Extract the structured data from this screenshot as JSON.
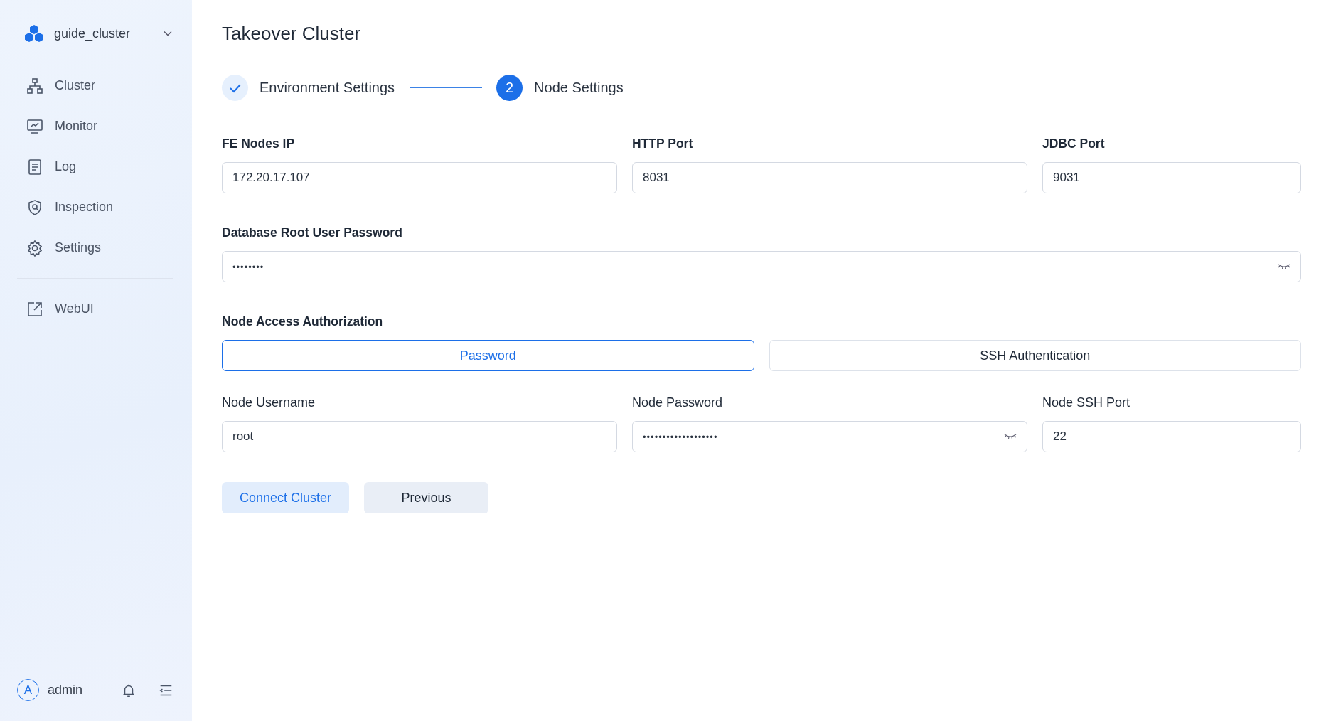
{
  "sidebar": {
    "cluster_name": "guide_cluster",
    "items": [
      {
        "label": "Cluster"
      },
      {
        "label": "Monitor"
      },
      {
        "label": "Log"
      },
      {
        "label": "Inspection"
      },
      {
        "label": "Settings"
      }
    ],
    "external_items": [
      {
        "label": "WebUI"
      }
    ],
    "user": {
      "avatar": "A",
      "name": "admin"
    }
  },
  "page_title": "Takeover Cluster",
  "steps": [
    {
      "label": "Environment Settings",
      "completed": true
    },
    {
      "label": "Node Settings",
      "completed": false,
      "number": "2"
    }
  ],
  "rows": [
    {
      "fields": [
        {
          "label": "FE Nodes IP",
          "kind": "text",
          "value": "172.20.17.107"
        },
        {
          "label": "HTTP Port",
          "kind": "text",
          "value": "8031"
        },
        {
          "label": "JDBC Port",
          "kind": "text",
          "value": "9031"
        }
      ]
    },
    {
      "fields": [
        {
          "label": "Database Root User Password",
          "kind": "password",
          "value": "••••••••"
        }
      ]
    }
  ],
  "auth": {
    "label": "Node Access Authorization",
    "options": [
      {
        "label": "Password",
        "selected": true
      },
      {
        "label": "SSH Authentication",
        "selected": false
      }
    ]
  },
  "node_fields": [
    {
      "label": "Node Username",
      "kind": "text",
      "value": "root"
    },
    {
      "label": "Node Password",
      "kind": "password",
      "value": "•••••••••••••••••••"
    },
    {
      "label": "Node SSH Port",
      "kind": "text",
      "value": "22"
    }
  ],
  "buttons": [
    {
      "label": "Connect Cluster",
      "kind": "primary"
    },
    {
      "label": "Previous",
      "kind": "secondary"
    }
  ]
}
